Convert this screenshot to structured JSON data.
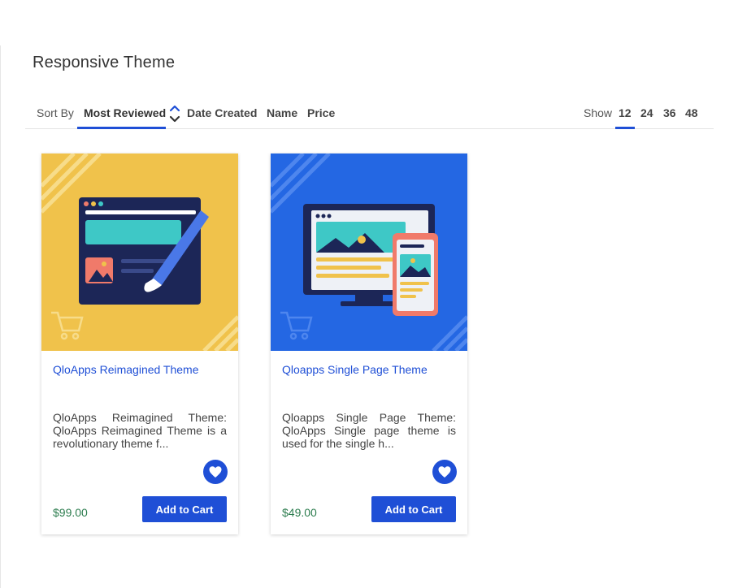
{
  "page": {
    "title": "Responsive Theme"
  },
  "sort": {
    "label": "Sort By",
    "options": [
      "Most Reviewed",
      "Date Created",
      "Name",
      "Price"
    ],
    "active": "Most Reviewed"
  },
  "show": {
    "label": "Show",
    "options": [
      "12",
      "24",
      "36",
      "48"
    ],
    "active": "12"
  },
  "products": [
    {
      "title": "QloApps Reimagined Theme",
      "description": "QloApps Reimagined Theme: QloApps Reimagined Theme is a revolutionary theme f...",
      "price": "$99.00",
      "button": "Add to Cart",
      "image_bg": "#f0c24b"
    },
    {
      "title": "Qloapps Single Page Theme",
      "description": "Qloapps Single Page Theme: QloApps Single page theme is used for the single h...",
      "price": "$49.00",
      "button": "Add to Cart",
      "image_bg": "#2467e3"
    }
  ],
  "colors": {
    "accent": "#1f4fd6",
    "price": "#2d7d4f"
  }
}
